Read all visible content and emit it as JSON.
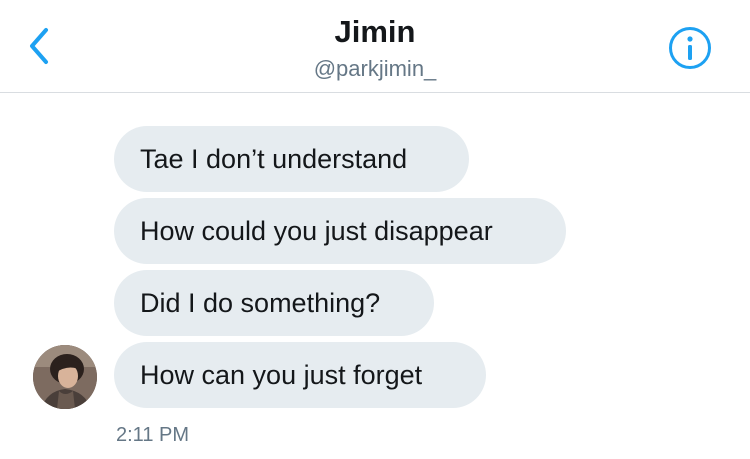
{
  "header": {
    "title": "Jimin",
    "handle": "@parkjimin_",
    "back_icon": "chevron-left-icon",
    "info_icon": "info-icon",
    "accent_color": "#1da1f2"
  },
  "conversation": {
    "messages": [
      {
        "text": "Tae I don’t understand"
      },
      {
        "text": "How could you just disappear"
      },
      {
        "text": "Did I do something?"
      },
      {
        "text": "How can you just forget"
      }
    ],
    "timestamp": "2:11 PM",
    "bubble_color": "#e6ecf0"
  }
}
